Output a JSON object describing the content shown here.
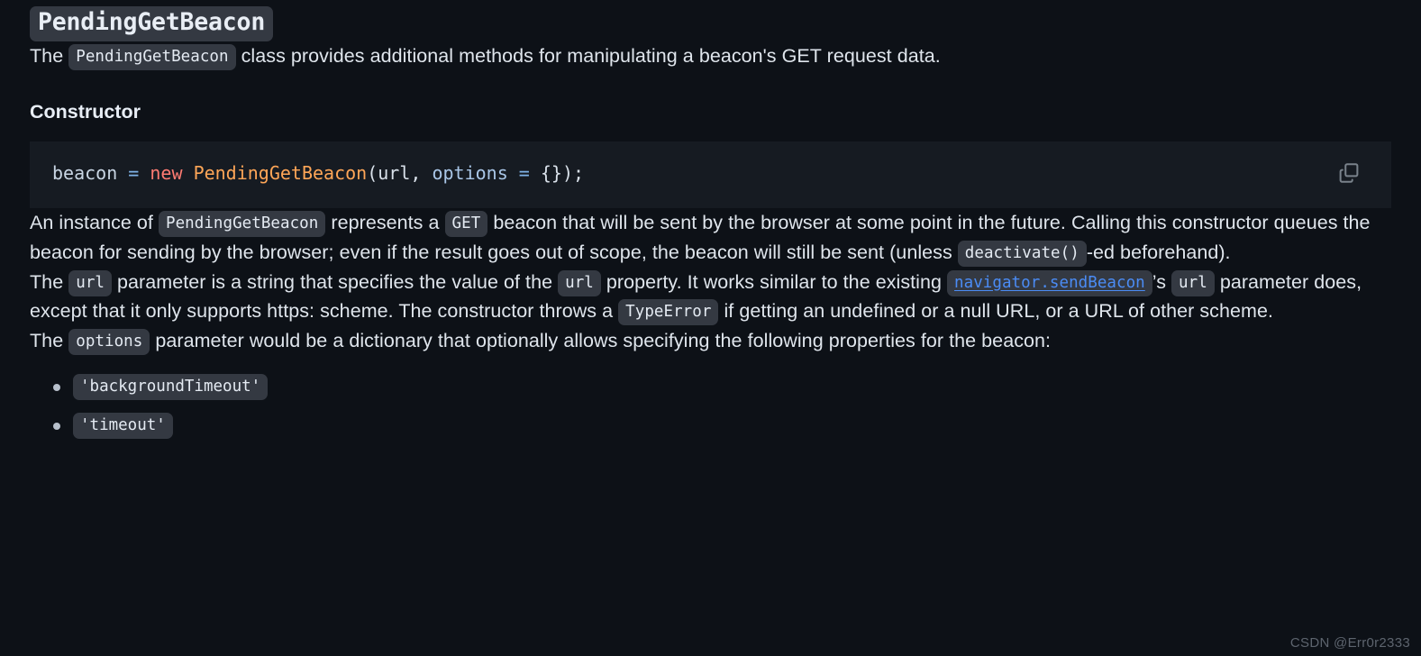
{
  "page": {
    "background_color": "#0d1117",
    "text_color": "#dfe5ec"
  },
  "title": {
    "text": "PendingGetBeacon",
    "chip_color": "#343942"
  },
  "intro": {
    "before": "The ",
    "code": "PendingGetBeacon",
    "after": " class provides additional methods for manipulating a beacon's GET request data."
  },
  "section_heading": "Constructor",
  "code_block": {
    "language": "js",
    "tokens": [
      {
        "text": "beacon ",
        "type": "variable",
        "color": "#c9d6e4"
      },
      {
        "text": "= ",
        "type": "operator",
        "color": "#7fb3e8"
      },
      {
        "text": "new ",
        "type": "keyword",
        "color": "#ff7b72"
      },
      {
        "text": "PendingGetBeacon",
        "type": "class",
        "color": "#ffa657"
      },
      {
        "text": "(url, ",
        "type": "punctuation",
        "color": "#d9e1ea"
      },
      {
        "text": "options ",
        "type": "parameter",
        "color": "#aac7e8"
      },
      {
        "text": "= ",
        "type": "operator",
        "color": "#7fb3e8"
      },
      {
        "text": "{});",
        "type": "punctuation",
        "color": "#d9e1ea"
      }
    ],
    "plain_text": "beacon = new PendingGetBeacon(url, options = {});",
    "copy_button_label": "copy-icon",
    "background_color": "#161b22"
  },
  "paragraph_instance": {
    "seg1": "An instance of ",
    "code1": "PendingGetBeacon",
    "seg2": " represents a ",
    "code2": "GET",
    "seg3": " beacon that will be sent by the browser at some point in the future. Calling this constructor queues the beacon for sending by the browser; even if the result goes out of scope, the beacon will still be sent (unless ",
    "code3": "deactivate()",
    "seg4": "-ed beforehand)."
  },
  "paragraph_url": {
    "seg1": "The ",
    "code1": "url",
    "seg2": " parameter is a string that specifies the value of the ",
    "code2": "url",
    "seg3": " property. It works similar to the existing ",
    "code_link": "navigator.sendBeacon",
    "code_link_color": "#4b8cf5",
    "seg4": "’s ",
    "code3": "url",
    "seg5": " parameter does, except that it only supports https: scheme. The constructor throws a ",
    "code4": "TypeError",
    "seg6": " if getting an undefined or a null URL, or a URL of other scheme."
  },
  "paragraph_options": {
    "seg1": "The ",
    "code1": "options",
    "seg2": " parameter would be a dictionary that optionally allows specifying the following properties for the beacon:"
  },
  "options_list": [
    "'backgroundTimeout'",
    "'timeout'"
  ],
  "watermark": "CSDN @Err0r2333"
}
